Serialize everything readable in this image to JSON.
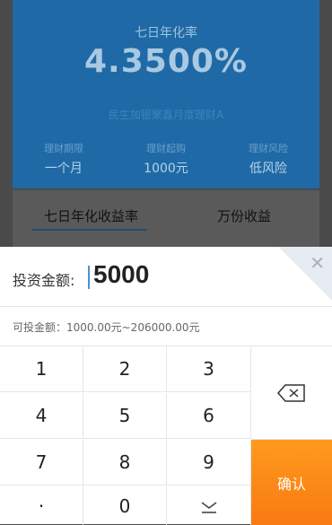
{
  "background": {
    "rate_title": "七日年化率",
    "rate_value": "4.3500%",
    "product_name": "民生加银聚鑫月度理财A",
    "stats": [
      {
        "label": "理财期限",
        "value": "一个月"
      },
      {
        "label": "理财起购",
        "value": "1000元"
      },
      {
        "label": "理财风险",
        "value": "低风险"
      }
    ],
    "tabs": [
      "七日年化收益率",
      "万份收益"
    ]
  },
  "keyboard": {
    "amount_label": "投资金额:",
    "amount_value": "5000",
    "range_text": "可投金额：1000.00元~206000.00元",
    "keys": [
      "1",
      "2",
      "3",
      "4",
      "5",
      "6",
      "7",
      "8",
      "9",
      "·",
      "0"
    ],
    "confirm_label": "确认",
    "icons": {
      "close": "close-icon",
      "delete": "backspace-icon",
      "hide": "hide-keyboard-icon"
    },
    "accent_color": "#f7861a"
  }
}
